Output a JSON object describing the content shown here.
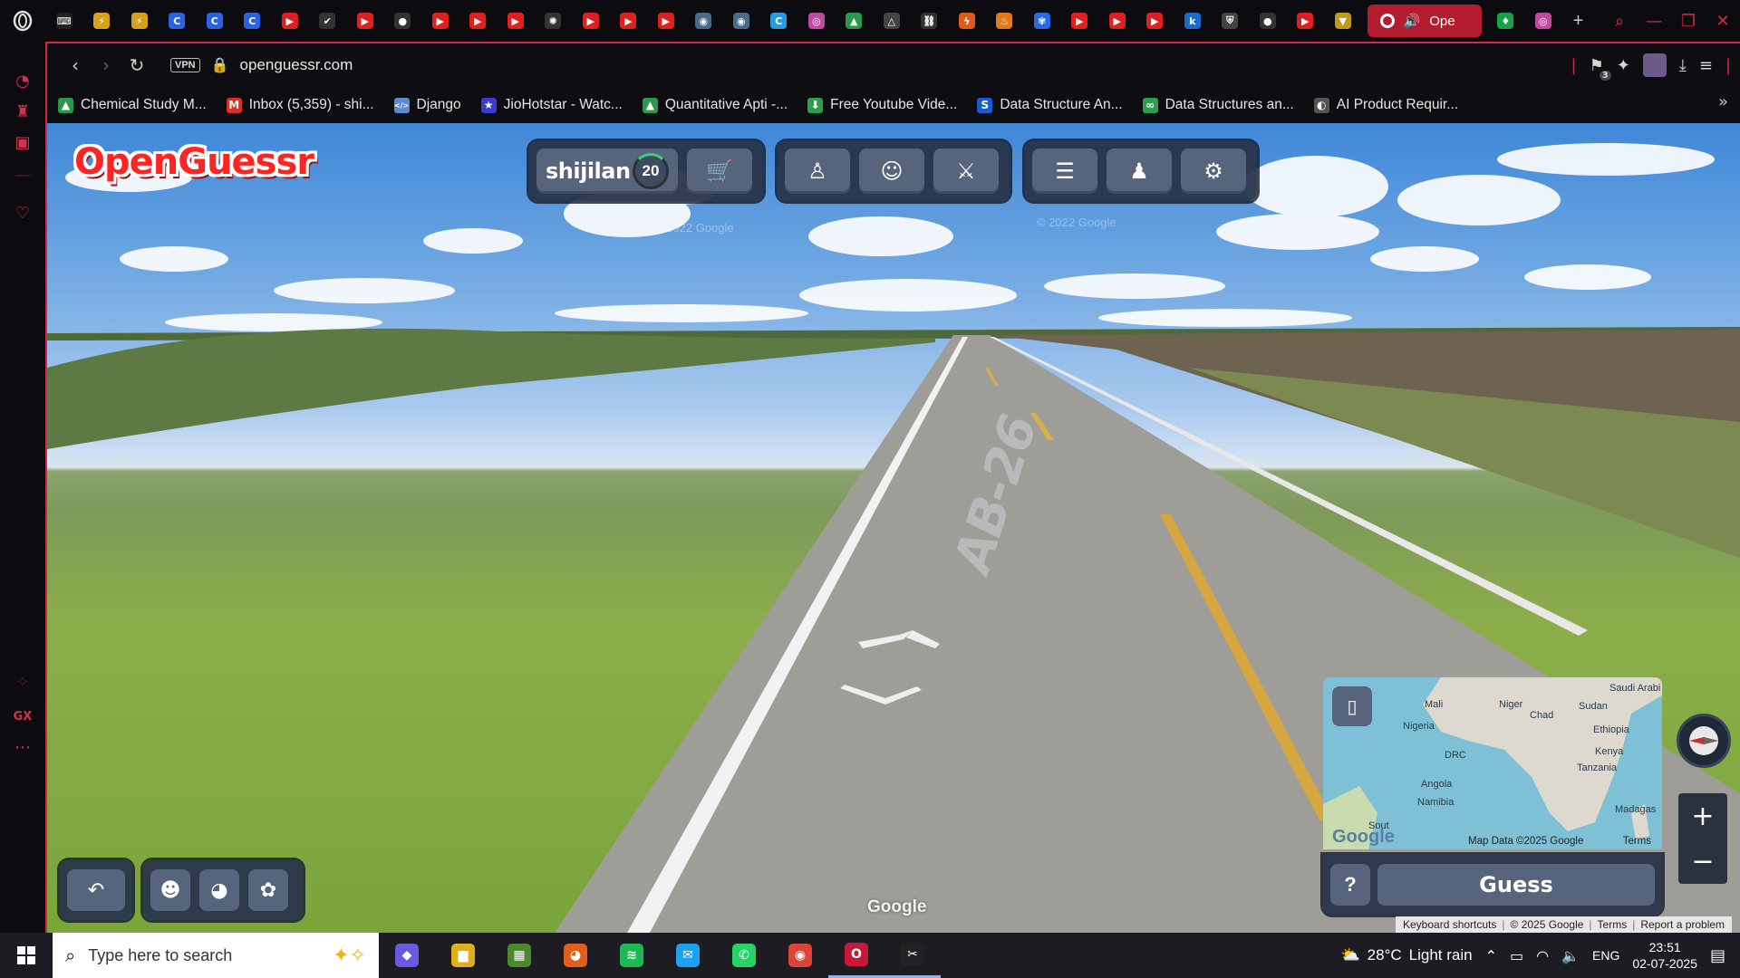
{
  "browser": {
    "url": "openguessr.com",
    "vpn_label": "VPN",
    "active_tab_label": "Ope",
    "tab_icons": [
      {
        "icon": "gamepad-icon",
        "glyph": "⌨",
        "color": "#222"
      },
      {
        "icon": "bolt-icon",
        "glyph": "⚡",
        "color": "#d9a01a"
      },
      {
        "icon": "bolt-icon",
        "glyph": "⚡",
        "color": "#d9a01a"
      },
      {
        "icon": "c-icon",
        "glyph": "C",
        "color": "#2a62e0"
      },
      {
        "icon": "c-icon",
        "glyph": "C",
        "color": "#2a62e0"
      },
      {
        "icon": "c-icon",
        "glyph": "C",
        "color": "#2a62e0"
      },
      {
        "icon": "youtube-icon",
        "glyph": "▶",
        "color": "#e02020"
      },
      {
        "icon": "check-icon",
        "glyph": "✔",
        "color": "#333"
      },
      {
        "icon": "youtube-icon",
        "glyph": "▶",
        "color": "#e02020"
      },
      {
        "icon": "github-icon",
        "glyph": "●",
        "color": "#333"
      },
      {
        "icon": "youtube-icon",
        "glyph": "▶",
        "color": "#e02020"
      },
      {
        "icon": "youtube-icon",
        "glyph": "▶",
        "color": "#e02020"
      },
      {
        "icon": "youtube-icon",
        "glyph": "▶",
        "color": "#e02020"
      },
      {
        "icon": "openai-icon",
        "glyph": "✺",
        "color": "#333"
      },
      {
        "icon": "youtube-icon",
        "glyph": "▶",
        "color": "#e02020"
      },
      {
        "icon": "youtube-icon",
        "glyph": "▶",
        "color": "#e02020"
      },
      {
        "icon": "youtube-icon",
        "glyph": "▶",
        "color": "#e02020"
      },
      {
        "icon": "eye-icon",
        "glyph": "◉",
        "color": "#4a6a8a"
      },
      {
        "icon": "eye-icon",
        "glyph": "◉",
        "color": "#4a6a8a"
      },
      {
        "icon": "c-icon",
        "glyph": "C",
        "color": "#2a9ae0"
      },
      {
        "icon": "gradient-icon",
        "glyph": "◎",
        "color": "#c04aa0"
      },
      {
        "icon": "drive-icon",
        "glyph": "▲",
        "color": "#2a9a4a"
      },
      {
        "icon": "triangle-icon",
        "glyph": "△",
        "color": "#444"
      },
      {
        "icon": "link-icon",
        "glyph": "⛓",
        "color": "#333"
      },
      {
        "icon": "flash-icon",
        "glyph": "ϟ",
        "color": "#e05a1a"
      },
      {
        "icon": "fire-icon",
        "glyph": "♨",
        "color": "#e07a1a"
      },
      {
        "icon": "butterfly-icon",
        "glyph": "✾",
        "color": "#2a6ae0"
      },
      {
        "icon": "youtube-icon",
        "glyph": "▶",
        "color": "#e02020"
      },
      {
        "icon": "youtube-icon",
        "glyph": "▶",
        "color": "#e02020"
      },
      {
        "icon": "youtube-icon",
        "glyph": "▶",
        "color": "#e02020"
      },
      {
        "icon": "k-icon",
        "glyph": "k",
        "color": "#1a6ad0"
      },
      {
        "icon": "shield-icon",
        "glyph": "⛨",
        "color": "#444"
      },
      {
        "icon": "github-icon",
        "glyph": "●",
        "color": "#333"
      },
      {
        "icon": "youtube-icon",
        "glyph": "▶",
        "color": "#e02020"
      },
      {
        "icon": "v-icon",
        "glyph": "▼",
        "color": "#c09a1a"
      }
    ],
    "tab_icons_after": [
      {
        "icon": "leaf-icon",
        "glyph": "♦",
        "color": "#1aa04a"
      },
      {
        "icon": "gradient-icon",
        "glyph": "◎",
        "color": "#c04aa0"
      }
    ],
    "bookmarks": [
      {
        "label": "Chemical Study M...",
        "icon": "drive-icon",
        "glyph": "▲",
        "color": "#2a9a4a"
      },
      {
        "label": "Inbox (5,359) - shi...",
        "icon": "gmail-icon",
        "glyph": "M",
        "color": "#d93025"
      },
      {
        "label": "Django",
        "icon": "code-icon",
        "glyph": "</>",
        "color": "#5a8ad0"
      },
      {
        "label": "JioHotstar - Watc...",
        "icon": "hotstar-icon",
        "glyph": "★",
        "color": "#3a3ad0"
      },
      {
        "label": "Quantitative Apti -...",
        "icon": "drive-icon",
        "glyph": "▲",
        "color": "#2a9a4a"
      },
      {
        "label": "Free Youtube Vide...",
        "icon": "download-icon",
        "glyph": "⬇",
        "color": "#2aa04a"
      },
      {
        "label": "Data Structure An...",
        "icon": "s-icon",
        "glyph": "S",
        "color": "#1a5ad0"
      },
      {
        "label": "Data Structures an...",
        "icon": "gg-icon",
        "glyph": "∞",
        "color": "#2aa04a"
      },
      {
        "label": "AI Product Requir...",
        "icon": "ai-icon",
        "glyph": "◐",
        "color": "#555"
      }
    ],
    "extensions_badge": "3"
  },
  "game": {
    "logo_text": "OpenGuessr",
    "username": "shijilan",
    "level": "20",
    "watermark_1": "© 2022 Google",
    "watermark_2": "© 2022 Google",
    "road_marking": "AB-26",
    "google_logo": "Google",
    "toolbar_icons": [
      "shop-icon",
      "leaderboard-icon",
      "party-icon",
      "battle-icon",
      "layers-icon",
      "profile-icon",
      "settings-icon"
    ],
    "bottom_left_icons": [
      "back-icon",
      "discord-icon",
      "reddit-icon",
      "bluesky-icon"
    ],
    "minimap": {
      "labels": [
        "Saudi Arabi",
        "Mali",
        "Niger",
        "Sudan",
        "Chad",
        "Nigeria",
        "Ethiopia",
        "Kenya",
        "DRC",
        "Tanzania",
        "Angola",
        "Namibia",
        "Madagas",
        "Sout"
      ],
      "attribution": "Map Data ©2025 Google",
      "terms": "Terms",
      "google_logo": "Google"
    },
    "help_label": "?",
    "guess_label": "Guess",
    "bottom_strip": {
      "shortcuts": "Keyboard shortcuts",
      "copyright": "© 2025 Google",
      "terms": "Terms",
      "report": "Report a problem"
    }
  },
  "taskbar": {
    "search_placeholder": "Type here to search",
    "apps": [
      {
        "icon": "copilot-icon",
        "glyph": "◆",
        "color": "#6a5ae0",
        "running": false
      },
      {
        "icon": "file-explorer-icon",
        "glyph": "▆",
        "color": "#e0b01a",
        "running": false
      },
      {
        "icon": "minecraft-icon",
        "glyph": "▦",
        "color": "#4a8a2a",
        "running": false
      },
      {
        "icon": "firefox-icon",
        "glyph": "◕",
        "color": "#e0601a",
        "running": false
      },
      {
        "icon": "spotify-icon",
        "glyph": "≋",
        "color": "#1db954",
        "running": false
      },
      {
        "icon": "twitter-icon",
        "glyph": "✉",
        "color": "#1da1f2",
        "running": false
      },
      {
        "icon": "whatsapp-icon",
        "glyph": "✆",
        "color": "#25d366",
        "running": false
      },
      {
        "icon": "chrome-icon",
        "glyph": "◉",
        "color": "#db4437",
        "running": false
      },
      {
        "icon": "opera-gx-icon",
        "glyph": "O",
        "color": "#c51a3a",
        "running": true
      },
      {
        "icon": "capcut-icon",
        "glyph": "✂",
        "color": "#222",
        "running": true
      }
    ],
    "weather_temp": "28°C",
    "weather_desc": "Light rain",
    "language": "ENG",
    "time": "23:51",
    "date": "02-07-2025"
  }
}
